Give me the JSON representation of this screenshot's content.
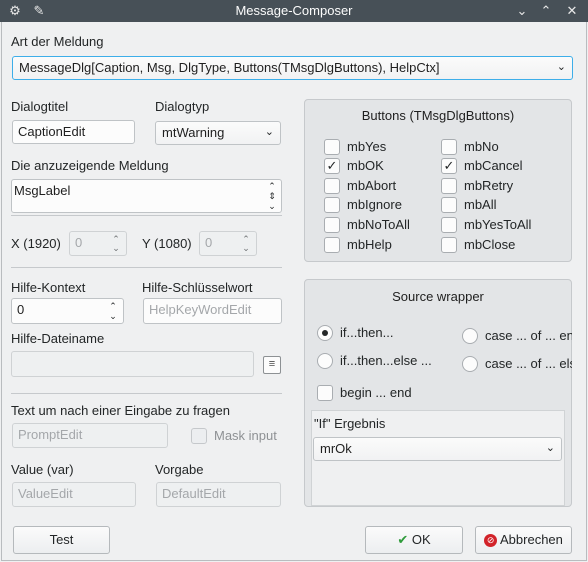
{
  "window": {
    "title": "Message-Composer"
  },
  "art": {
    "label": "Art der Meldung",
    "value": "MessageDlg[Caption, Msg, DlgType, Buttons(TMsgDlgButtons), HelpCtx]"
  },
  "dialogtitel": {
    "label": "Dialogtitel",
    "value": "CaptionEdit"
  },
  "dialogtyp": {
    "label": "Dialogtyp",
    "value": "mtWarning"
  },
  "meldung": {
    "label": "Die anzuzeigende Meldung",
    "value": "MsgLabel"
  },
  "pos": {
    "x_label": "X (1920)",
    "x_value": "0",
    "y_label": "Y (1080)",
    "y_value": "0"
  },
  "hilfe": {
    "kontext_label": "Hilfe-Kontext",
    "kontext_value": "0",
    "schluessel_label": "Hilfe-Schlüsselwort",
    "schluessel_placeholder": "HelpKeyWordEdit",
    "datei_label": "Hilfe-Dateiname",
    "datei_value": ""
  },
  "prompt": {
    "label": "Text um nach einer Eingabe zu fragen",
    "placeholder": "PromptEdit",
    "mask_label": "Mask input"
  },
  "value": {
    "label": "Value (var)",
    "placeholder": "ValueEdit",
    "vorgabe_label": "Vorgabe",
    "vorgabe_placeholder": "DefaultEdit"
  },
  "buttons_group": {
    "title": "Buttons (TMsgDlgButtons)",
    "items": [
      {
        "label": "mbYes",
        "checked": false
      },
      {
        "label": "mbNo",
        "checked": false
      },
      {
        "label": "mbOK",
        "checked": true
      },
      {
        "label": "mbCancel",
        "checked": true
      },
      {
        "label": "mbAbort",
        "checked": false
      },
      {
        "label": "mbRetry",
        "checked": false
      },
      {
        "label": "mbIgnore",
        "checked": false
      },
      {
        "label": "mbAll",
        "checked": false
      },
      {
        "label": "mbNoToAll",
        "checked": false
      },
      {
        "label": "mbYesToAll",
        "checked": false
      },
      {
        "label": "mbHelp",
        "checked": false
      },
      {
        "label": "mbClose",
        "checked": false
      }
    ]
  },
  "source": {
    "title": "Source wrapper",
    "radio_ifthen": "if...then...",
    "radio_case": "case ... of ... end",
    "radio_ifthenelse": "if...then...else ...",
    "radio_caseelse": "case ... of ... else",
    "begin_end": "begin ... end",
    "if_label": "\"If\" Ergebnis",
    "if_value": "mrOk"
  },
  "footer": {
    "test": "Test",
    "ok": "OK",
    "cancel": "Abbrechen"
  },
  "colors": {
    "accent": "#3daee9",
    "titlebar": "#475057",
    "ok_green": "#2e9b3a",
    "cancel_red": "#d2232a"
  }
}
